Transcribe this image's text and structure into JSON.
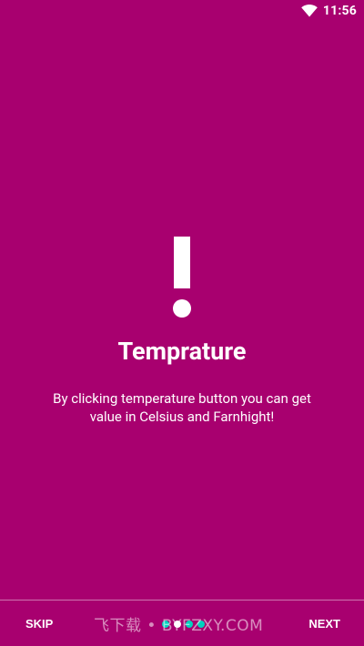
{
  "status_bar": {
    "time": "11:56",
    "wifi_icon": "wifi-icon"
  },
  "slide": {
    "icon": "exclamation-icon",
    "title": "Temprature",
    "description": "By clicking temperature button you can get value in Celsius and Farnhight!"
  },
  "navigation": {
    "skip_label": "SKIP",
    "next_label": "NEXT",
    "page_count": 4,
    "active_page": 2
  },
  "watermark": "飞下载 • BYFZXY.COM",
  "colors": {
    "background": "#A8006F",
    "text": "#FFFFFF",
    "inactive_dot": "#00D2BE"
  }
}
